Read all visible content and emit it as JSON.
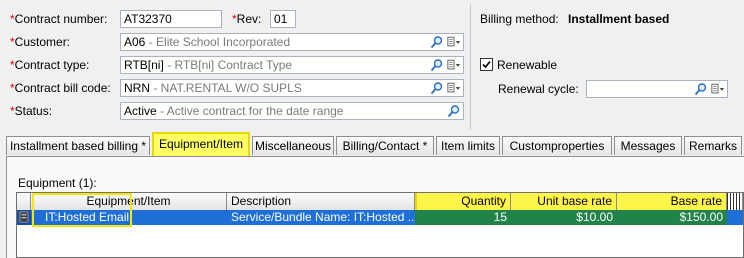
{
  "header": {
    "contract_number": {
      "label": "Contract number:",
      "value": "AT32370"
    },
    "rev": {
      "label": "Rev:",
      "value": "01"
    },
    "customer": {
      "label": "Customer:",
      "code": "A06",
      "description": "Elite School Incorporated"
    },
    "contract_type": {
      "label": "Contract type:",
      "code": "RTB[ni]",
      "description": "RTB[ni] Contract Type"
    },
    "contract_bill_code": {
      "label": "Contract bill code:",
      "code": "NRN",
      "description": "NAT.RENTAL W/O SUPLS"
    },
    "status": {
      "label": "Status:",
      "code": "Active",
      "description": "Active contract for the date range"
    },
    "required_mark": "*",
    "separator": " - "
  },
  "billing": {
    "method_label": "Billing method:",
    "method_value": "Installment based",
    "renewable_label": "Renewable",
    "renewable_checked": true,
    "renewal_cycle_label": "Renewal cycle:",
    "renewal_cycle_value": ""
  },
  "tabs": [
    {
      "label": "Installment based billing *",
      "active": false
    },
    {
      "label": "Equipment/Item",
      "active": true
    },
    {
      "label": "Miscellaneous",
      "active": false
    },
    {
      "label": "Billing/Contact *",
      "active": false
    },
    {
      "label": "Item limits",
      "active": false
    },
    {
      "label": "Customproperties",
      "active": false
    },
    {
      "label": "Messages",
      "active": false
    },
    {
      "label": "Remarks",
      "active": false
    }
  ],
  "equipment": {
    "section_label": "Equipment (1):",
    "columns": [
      "Equipment/Item",
      "Description",
      "Quantity",
      "Unit base rate",
      "Base rate"
    ],
    "rows": [
      {
        "item": "IT:Hosted Email",
        "description": "Service/Bundle Name: IT:Hosted ...",
        "quantity": "15",
        "unit_base_rate": "$10.00",
        "base_rate": "$150.00"
      }
    ]
  },
  "colors": {
    "required": "#e00000",
    "row_selected": "#1e6fd8",
    "highlight": "#fff44a",
    "green_cell": "#21834a"
  }
}
